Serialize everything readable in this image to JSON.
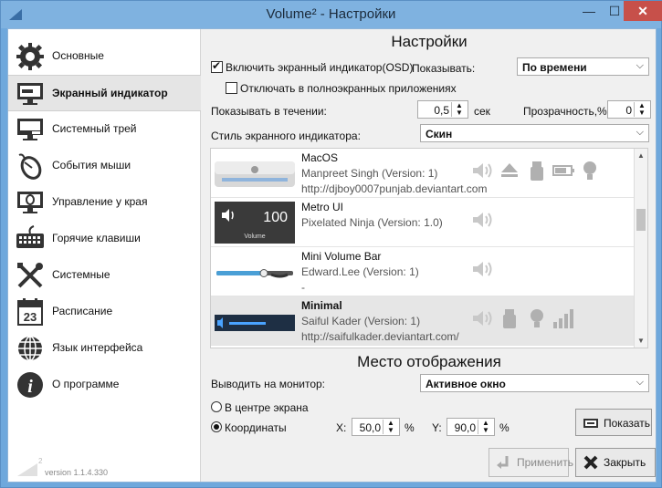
{
  "window": {
    "title": "Volume² - Настройки",
    "minimize": "—",
    "maximize": "☐",
    "close": "✕"
  },
  "sidebar": {
    "items": [
      {
        "label": "Основные",
        "icon": "gear-icon"
      },
      {
        "label": "Экранный индикатор",
        "icon": "monitor-icon"
      },
      {
        "label": "Системный трей",
        "icon": "tray-icon"
      },
      {
        "label": "События мыши",
        "icon": "mouse-icon"
      },
      {
        "label": "Управление у края",
        "icon": "screen-edge-icon"
      },
      {
        "label": "Горячие клавиши",
        "icon": "keyboard-icon"
      },
      {
        "label": "Системные",
        "icon": "tools-icon"
      },
      {
        "label": "Расписание",
        "icon": "calendar-icon"
      },
      {
        "label": "Язык интерфейса",
        "icon": "globe-icon"
      },
      {
        "label": "О программе",
        "icon": "info-icon"
      }
    ],
    "active_index": 1,
    "calendar_day": "23",
    "logo_superscript": "2",
    "version": "version 1.1.4.330"
  },
  "settings": {
    "title": "Настройки",
    "osd_enable_label": "Включить экранный индикатор(OSD)",
    "osd_enabled": true,
    "show_label": "Показывать:",
    "show_value": "По времени",
    "fullscreen_label": "Отключать в полноэкранных приложениях",
    "fullscreen_checked": false,
    "duration_label": "Показывать в течении:",
    "duration_value": "0,5",
    "duration_unit": "сек",
    "opacity_label": "Прозрачность,%:",
    "opacity_value": "0",
    "style_label": "Стиль экранного индикатора:",
    "style_value": "Скин"
  },
  "skins": [
    {
      "name": "MacOS",
      "author": "Manpreet Singh (Version: 1)",
      "url": "http://djboy0007punjab.deviantart.com",
      "selected": false
    },
    {
      "name": "Metro UI",
      "author": "Pixelated Ninja (Version: 1.0)",
      "url": "",
      "selected": false,
      "preview_number": "100",
      "preview_caption": "Volume"
    },
    {
      "name": "Mini Volume Bar",
      "author": "Edward.Lee (Version: 1)",
      "url": "-",
      "selected": false
    },
    {
      "name": "Minimal",
      "author": "Saiful Kader (Version: 1)",
      "url": "http://saifulkader.deviantart.com/",
      "selected": true
    }
  ],
  "placement": {
    "title": "Место отображения",
    "monitor_label": "Выводить на монитор:",
    "monitor_value": "Активное окно",
    "center_label": "В центре экрана",
    "coords_label": "Координаты",
    "mode": "coords",
    "x_label": "X:",
    "x_value": "50,0",
    "y_label": "Y:",
    "y_value": "90,0",
    "percent": "%",
    "show_button": "Показать"
  },
  "footer": {
    "apply_button": "Применить",
    "close_button": "Закрыть"
  },
  "colors": {
    "title_bar": "#7fb2e0",
    "close_button": "#c7504a",
    "selected_row": "#e6e6e6"
  }
}
